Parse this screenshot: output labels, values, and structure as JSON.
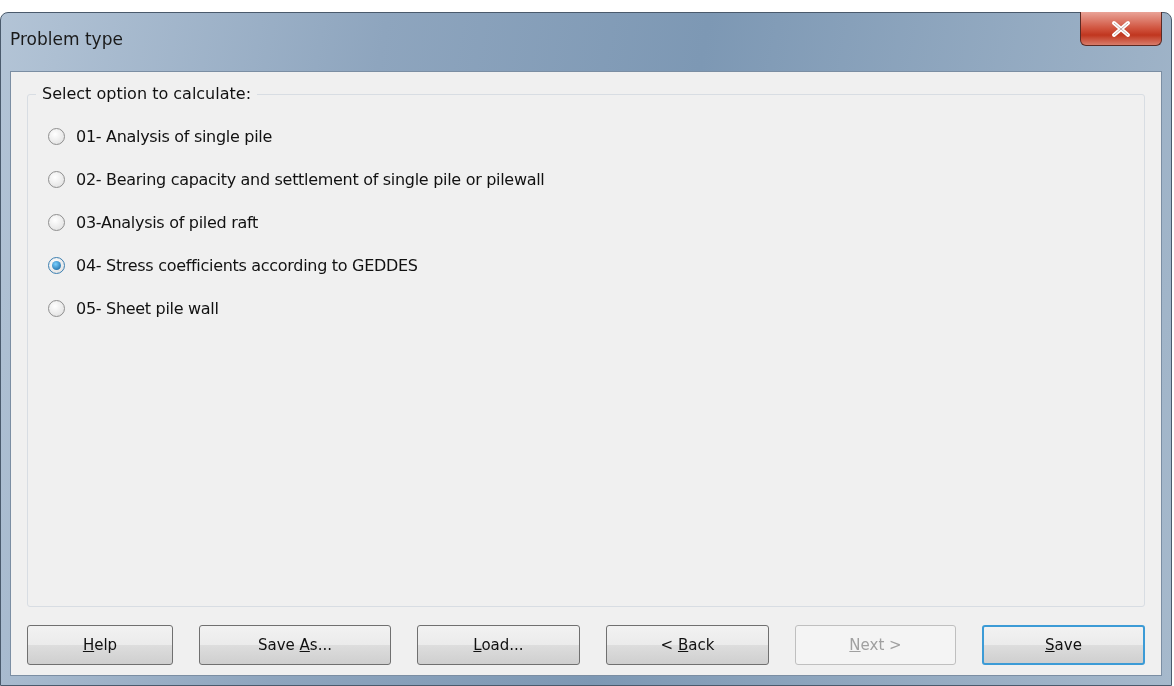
{
  "window": {
    "title": "Problem type"
  },
  "group": {
    "title": "Select option to calculate:"
  },
  "options": [
    {
      "label": "01- Analysis of single pile",
      "selected": false
    },
    {
      "label": "02- Bearing capacity and settlement of single pile or pilewall",
      "selected": false
    },
    {
      "label": "03-Analysis of piled raft",
      "selected": false
    },
    {
      "label": "04- Stress coefficients according to GEDDES",
      "selected": true
    },
    {
      "label": "05- Sheet pile wall",
      "selected": false
    }
  ],
  "buttons": [
    {
      "key": "H",
      "post": "elp",
      "disabled": false,
      "default": false
    },
    {
      "pre": "Save ",
      "key": "A",
      "post": "s...",
      "disabled": false,
      "default": false
    },
    {
      "key": "L",
      "post": "oad...",
      "disabled": false,
      "default": false
    },
    {
      "pre": "< ",
      "key": "B",
      "post": "ack",
      "disabled": false,
      "default": false
    },
    {
      "key": "N",
      "post": "ext >",
      "disabled": true,
      "default": false
    },
    {
      "key": "S",
      "post": "ave",
      "disabled": false,
      "default": true
    }
  ]
}
